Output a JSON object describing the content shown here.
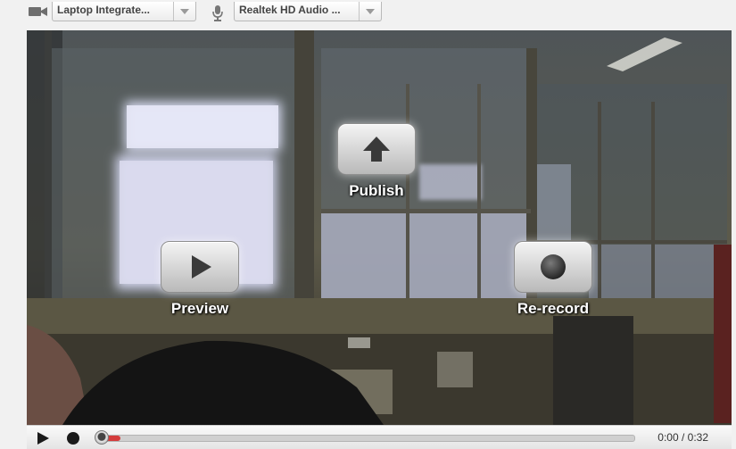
{
  "devices": {
    "camera": {
      "icon": "video-camera-icon",
      "label": "Laptop Integrate..."
    },
    "microphone": {
      "icon": "microphone-icon",
      "label": "Realtek HD Audio ..."
    }
  },
  "overlay": {
    "publish_label": "Publish",
    "preview_label": "Preview",
    "rerecord_label": "Re-record"
  },
  "player": {
    "current_time": "0:00",
    "separator": " / ",
    "duration": "0:32",
    "progress_fraction": 0.0,
    "accent_color": "#d43c3c"
  }
}
